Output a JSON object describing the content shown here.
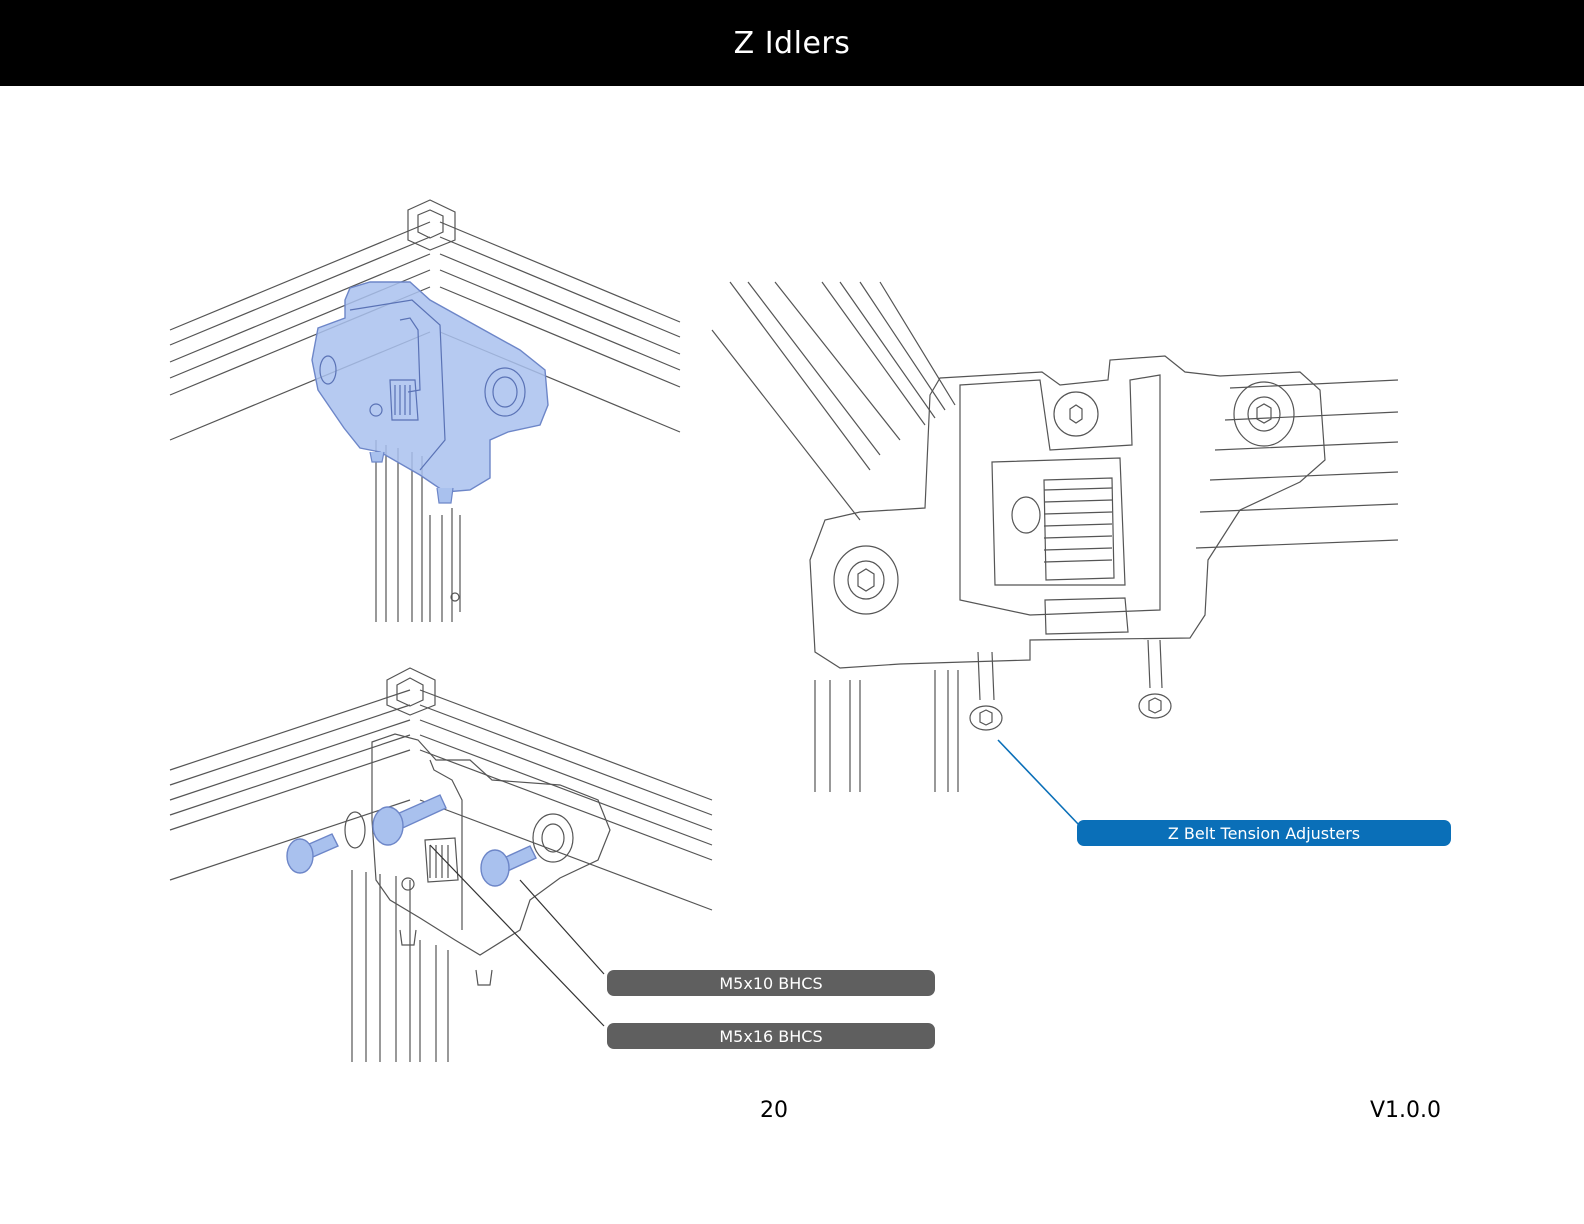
{
  "header": {
    "title": "Z Idlers"
  },
  "callouts": {
    "tension": {
      "label": "Z Belt Tension Adjusters",
      "color": "#0a6fb8"
    },
    "m5x10": {
      "label": "M5x10 BHCS",
      "color": "#5f5f5f"
    },
    "m5x16": {
      "label": "M5x16 BHCS",
      "color": "#5f5f5f"
    }
  },
  "footer": {
    "page_number": "20",
    "version": "V1.0.0"
  },
  "colors": {
    "highlight": "#a9c1ee",
    "line": "#444444"
  }
}
